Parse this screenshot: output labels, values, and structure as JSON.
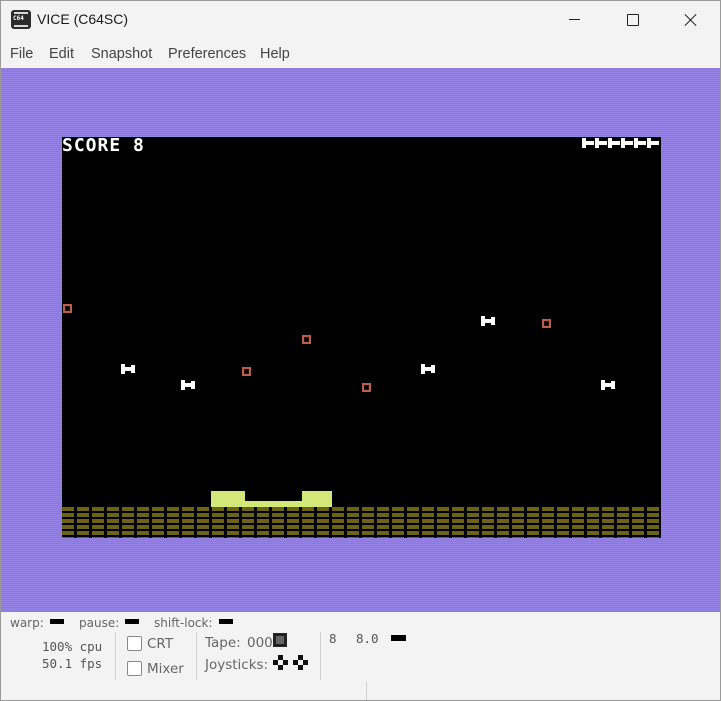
{
  "window": {
    "title": "VICE (C64SC)",
    "icon": "c64-app-icon",
    "icon_text": "C64"
  },
  "menu": [
    "File",
    "Edit",
    "Snapshot",
    "Preferences",
    "Help"
  ],
  "game": {
    "score_text": "SCORE 8",
    "lives": 6
  },
  "status": {
    "warp_label": "warp:",
    "pause_label": "pause:",
    "shiftlock_label": "shift-lock:",
    "cpu": "100% cpu",
    "fps": "50.1 fps",
    "crt_label": "CRT",
    "mixer_label": "Mixer",
    "tape_label": "Tape:",
    "tape_counter": "000",
    "joysticks_label": "Joysticks:",
    "drive_unit": "8",
    "drive_track": "8.0"
  },
  "colors": {
    "border": "#9180e0",
    "screen": "#000000",
    "base": "#d4e87a",
    "bricks": "#6b6418",
    "crate": "#b86050"
  }
}
